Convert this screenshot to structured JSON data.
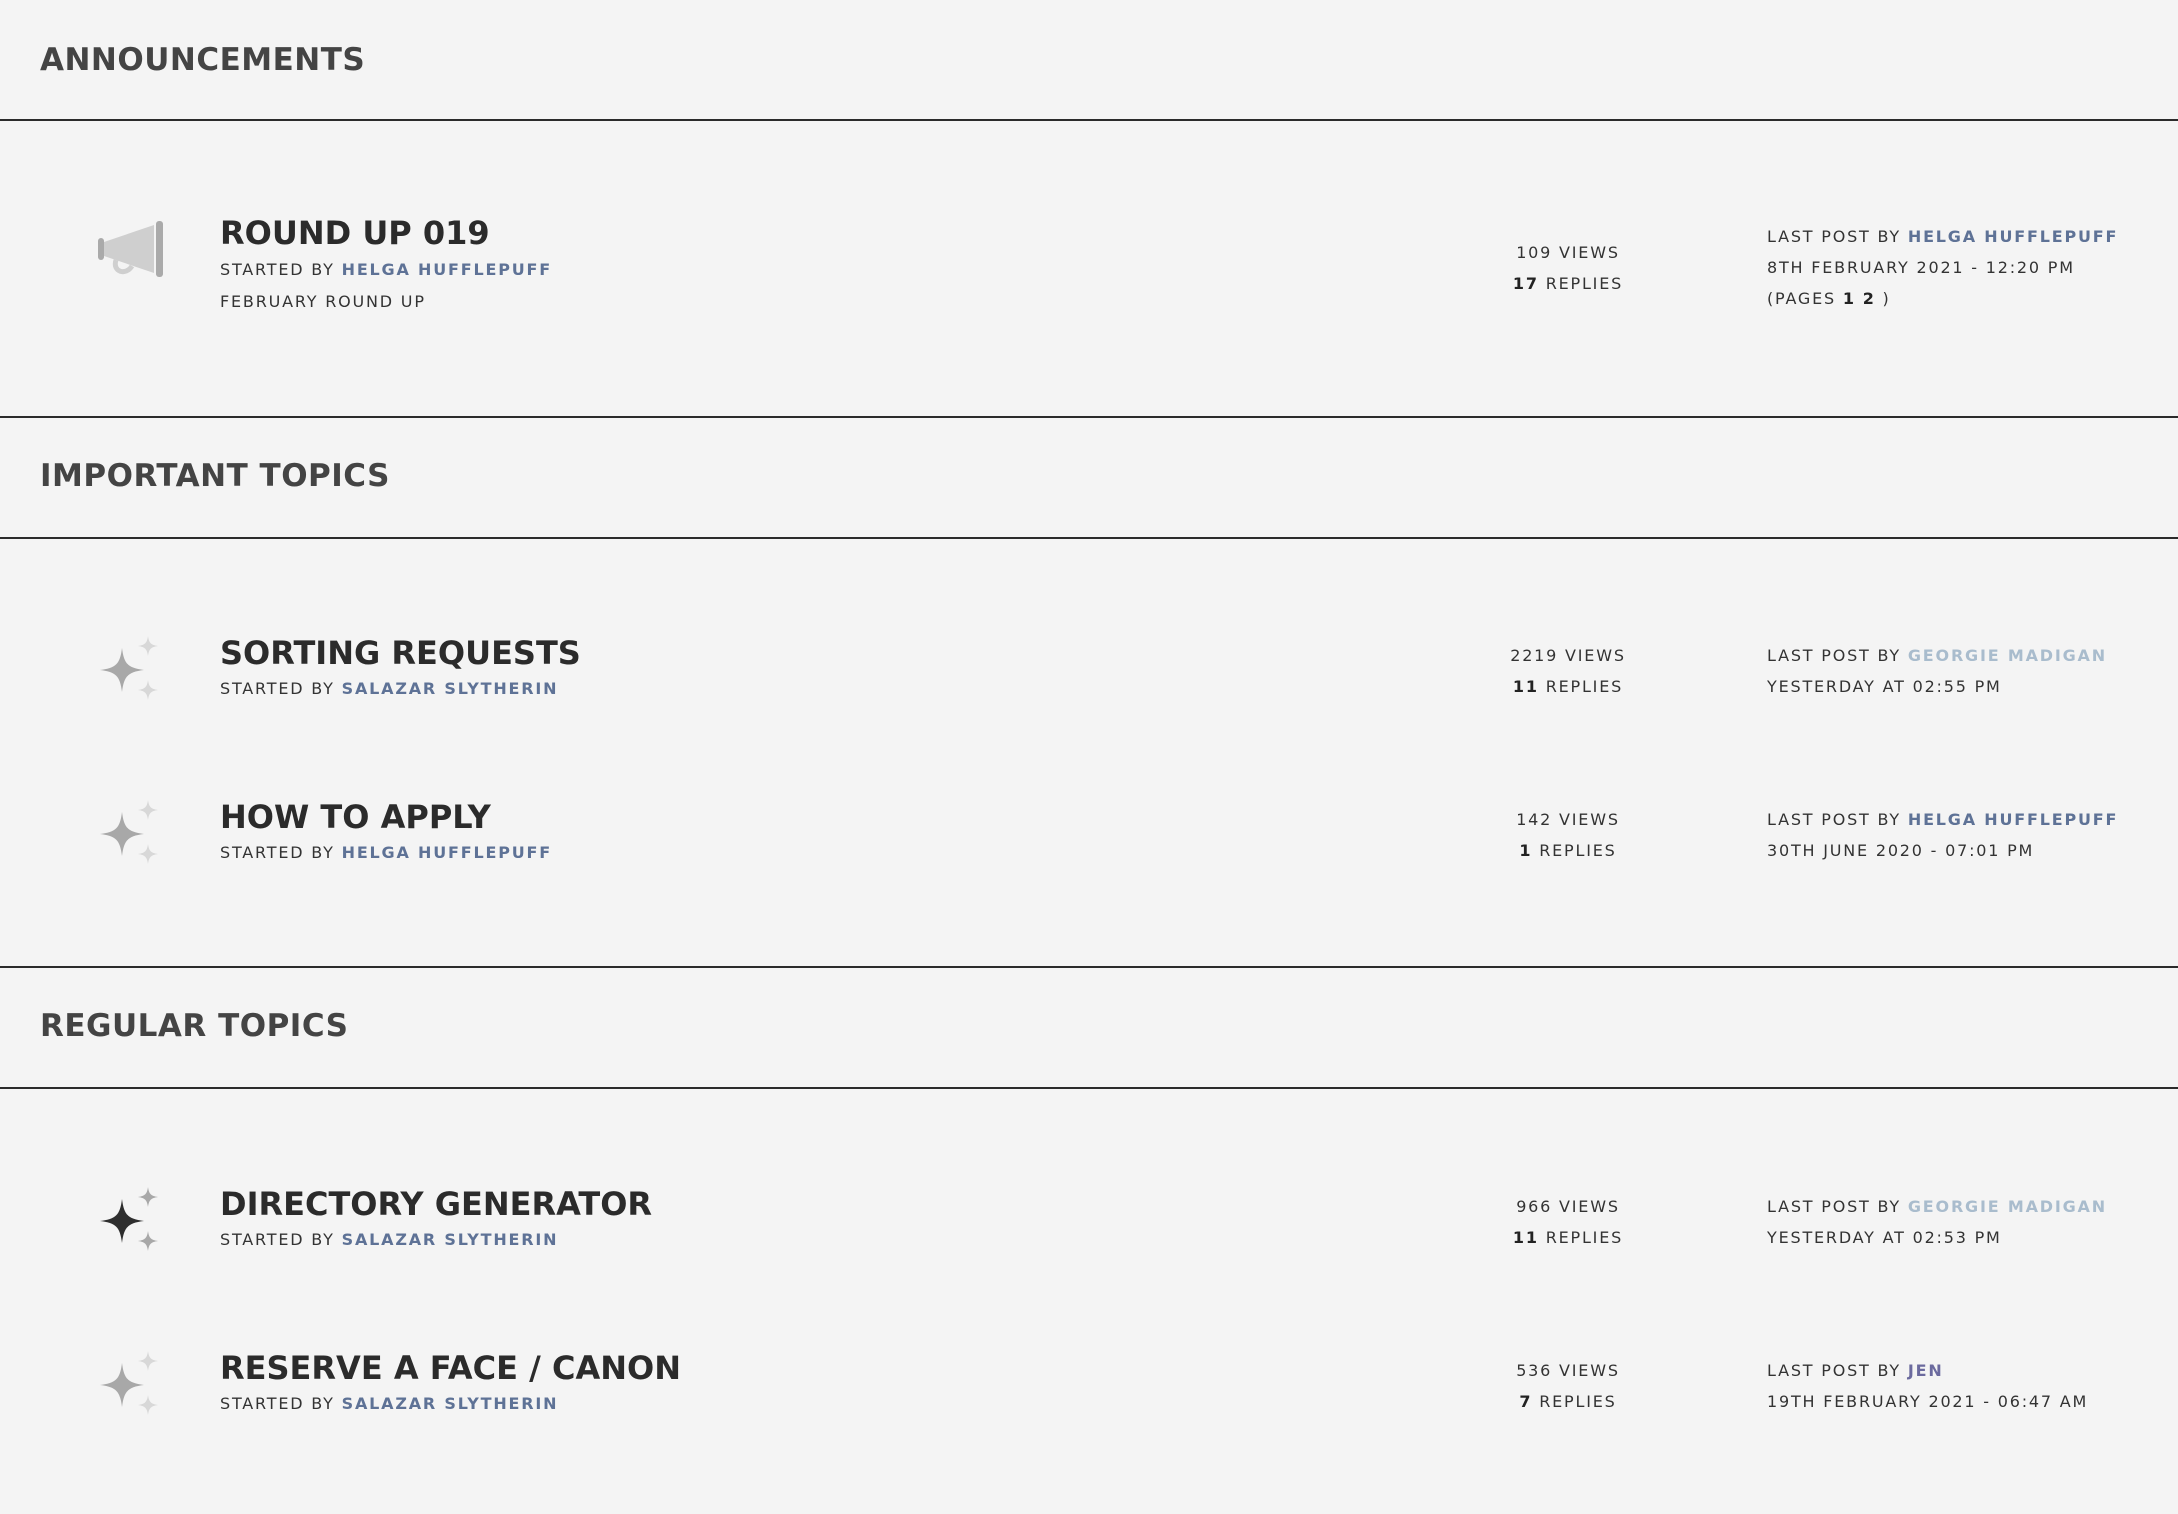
{
  "sections": [
    {
      "title": "ANNOUNCEMENTS",
      "topics": [
        {
          "title": "ROUND UP 019",
          "started_by_prefix": "STARTED BY",
          "author": "HELGA HUFFLEPUFF",
          "description": "FEBRUARY ROUND UP",
          "views": "109",
          "views_label": "VIEWS",
          "replies": "17",
          "replies_label": "REPLIES",
          "last_post_prefix": "LAST POST BY",
          "last_post_author": "HELGA HUFFLEPUFF",
          "last_post_date": "8TH FEBRUARY 2021 - 12:20 PM",
          "pages_prefix": "(PAGES",
          "pages": [
            "1",
            "2"
          ],
          "pages_suffix": ")",
          "icon": "megaphone-icon"
        }
      ]
    },
    {
      "title": "IMPORTANT TOPICS",
      "topics": [
        {
          "title": "SORTING REQUESTS",
          "started_by_prefix": "STARTED BY",
          "author": "SALAZAR SLYTHERIN",
          "views": "2219",
          "views_label": "VIEWS",
          "replies": "11",
          "replies_label": "REPLIES",
          "last_post_prefix": "LAST POST BY",
          "last_post_author": "GEORGIE MADIGAN",
          "last_post_date": "YESTERDAY AT 02:55 PM",
          "icon": "sparkle-icon"
        },
        {
          "title": "HOW TO APPLY",
          "started_by_prefix": "STARTED BY",
          "author": "HELGA HUFFLEPUFF",
          "views": "142",
          "views_label": "VIEWS",
          "replies": "1",
          "replies_label": "REPLIES",
          "last_post_prefix": "LAST POST BY",
          "last_post_author": "HELGA HUFFLEPUFF",
          "last_post_date": "30TH JUNE 2020 - 07:01 PM",
          "icon": "sparkle-icon"
        }
      ]
    },
    {
      "title": "REGULAR TOPICS",
      "topics": [
        {
          "title": "DIRECTORY GENERATOR",
          "started_by_prefix": "STARTED BY",
          "author": "SALAZAR SLYTHERIN",
          "views": "966",
          "views_label": "VIEWS",
          "replies": "11",
          "replies_label": "REPLIES",
          "last_post_prefix": "LAST POST BY",
          "last_post_author": "GEORGIE MADIGAN",
          "last_post_date": "YESTERDAY AT 02:53 PM",
          "icon": "sparkle-dark-icon"
        },
        {
          "title": "RESERVE A FACE / CANON",
          "started_by_prefix": "STARTED BY",
          "author": "SALAZAR SLYTHERIN",
          "views": "536",
          "views_label": "VIEWS",
          "replies": "7",
          "replies_label": "REPLIES",
          "last_post_prefix": "LAST POST BY",
          "last_post_author": "JEN",
          "last_post_date": "19TH FEBRUARY 2021 - 06:47 AM",
          "icon": "sparkle-icon"
        }
      ]
    }
  ],
  "colors": {
    "background": "#f4f4f4",
    "author_link": "#5e7296",
    "author_light": "#a9bccd",
    "author_purple": "#6b6a9e",
    "heading": "#444444"
  }
}
